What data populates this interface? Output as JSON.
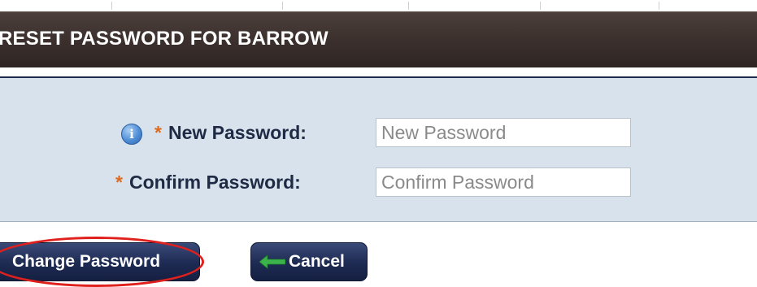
{
  "dialog": {
    "title": "RESET PASSWORD FOR BARROW"
  },
  "form": {
    "new_password": {
      "required_mark": "*",
      "label": "New Password:",
      "placeholder": "New Password",
      "info_icon": "info-icon"
    },
    "confirm_password": {
      "required_mark": "*",
      "label": "Confirm Password:",
      "placeholder": "Confirm Password"
    }
  },
  "buttons": {
    "change_password": "Change Password",
    "cancel": "Cancel",
    "cancel_icon": "back-arrow-icon"
  },
  "colors": {
    "header_bg": "#3a2f2c",
    "panel_bg": "#d7e2ec",
    "button_bg": "#1d2a52",
    "required_mark": "#e06a1c",
    "highlight_ring": "#e0201c",
    "arrow": "#3bb34a"
  }
}
